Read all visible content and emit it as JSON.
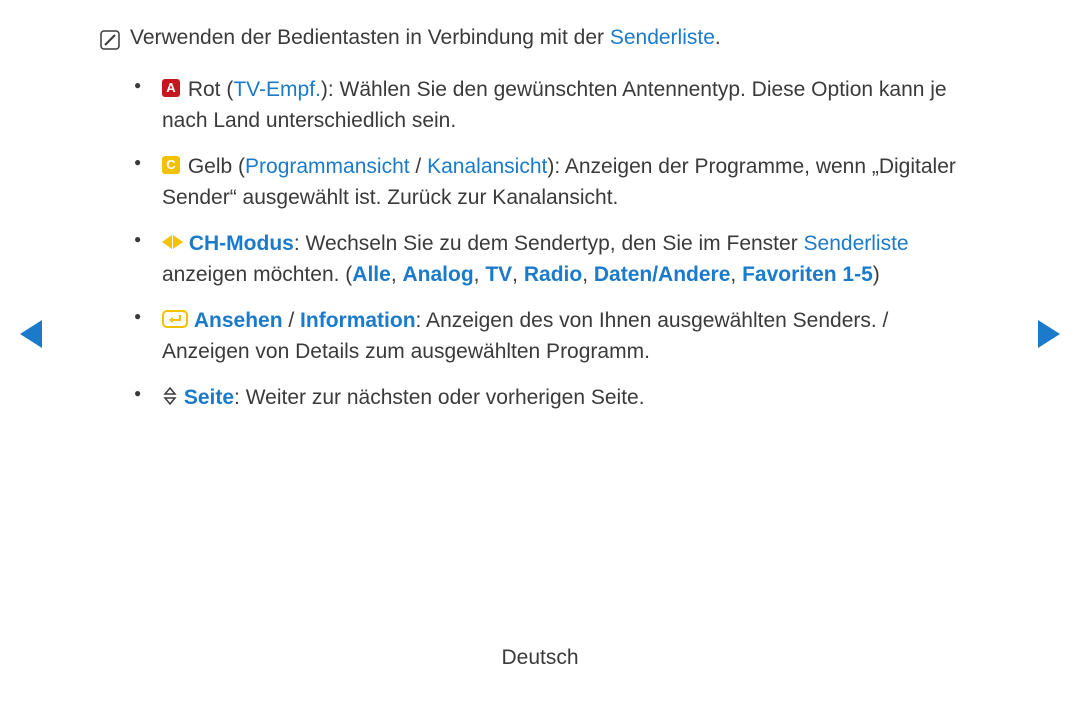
{
  "intro": {
    "prefix": "Verwenden der Bedientasten in Verbindung mit der ",
    "link": "Senderliste",
    "suffix": "."
  },
  "items": {
    "rot": {
      "badge": "A",
      "label1": " Rot (",
      "link1": "TV-Empf.",
      "after": "): Wählen Sie den gewünschten Antennentyp. Diese Option kann je nach Land unterschiedlich sein."
    },
    "gelb": {
      "badge": "C",
      "label1": " Gelb (",
      "link1": "Programmansicht",
      "sep": " / ",
      "link2": "Kanalansicht",
      "after": "): Anzeigen der Programme, wenn „Digitaler Sender“ ausgewählt ist. Zurück zur Kanalansicht."
    },
    "chmodus": {
      "title": "CH-Modus",
      "after1": ": Wechseln Sie zu dem Sendertyp, den Sie im Fenster ",
      "link_sl": "Senderliste",
      "after2": " anzeigen möchten. (",
      "o1": "Alle",
      "c": ", ",
      "o2": "Analog",
      "o3": "TV",
      "o4": "Radio",
      "o5": "Daten/Andere",
      "o6": "Favoriten 1-5",
      "close": ")"
    },
    "ansehen": {
      "link1": "Ansehen",
      "sep": " / ",
      "link2": "Information",
      "after": ": Anzeigen des von Ihnen ausgewählten Senders. / Anzeigen von Details zum ausgewählten Programm."
    },
    "seite": {
      "link": "Seite",
      "after": ": Weiter zur nächsten oder vorherigen Seite."
    }
  },
  "footer": "Deutsch"
}
